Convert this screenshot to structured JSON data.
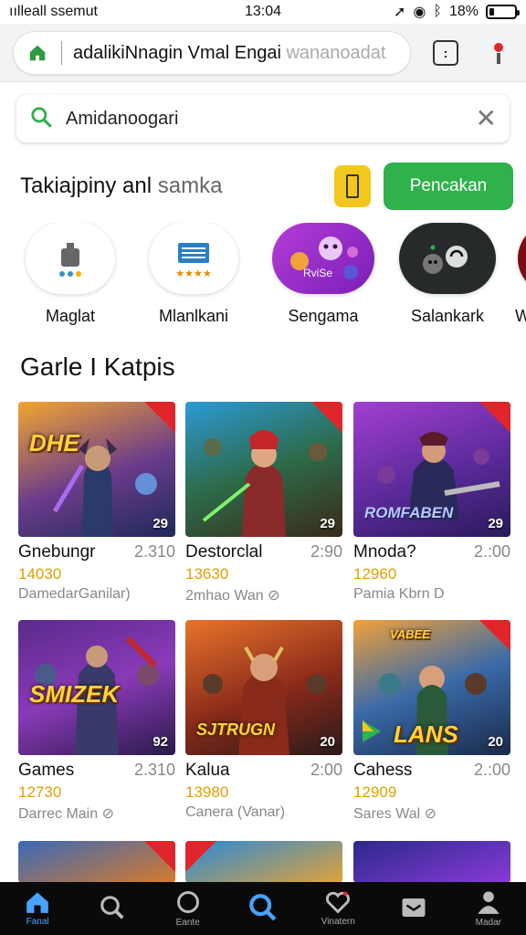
{
  "status_bar": {
    "carrier": "ıılleall ssemut",
    "clock": "13:04",
    "battery": "18%",
    "battery_level": 0.18
  },
  "url_bar": {
    "url_text": "adalikiNnagin Vmal Engai",
    "url_faded": "wananoadat",
    "tabs_count": ":"
  },
  "search": {
    "query": "Amidanoogari"
  },
  "section": {
    "title": "Takiajpiny anl",
    "title_faded": "samka",
    "action_button": "Pencakan"
  },
  "categories": [
    {
      "label": "Maglat",
      "icon": "package-icon"
    },
    {
      "label": "Mlanlkani",
      "icon": "list-icon"
    },
    {
      "label": "Sengama",
      "icon": "monster-faces-icon",
      "caption": "RviSe"
    },
    {
      "label": "Salankark",
      "icon": "bomb-icon"
    },
    {
      "label": "W",
      "icon": "partial-icon"
    }
  ],
  "games_heading": "Garle I Katpis",
  "games": [
    {
      "name": "Gnebungr",
      "price": "2.310",
      "count": "14030",
      "sub": "DamedarGanilar)",
      "rating": "29",
      "banner": "DHE"
    },
    {
      "name": "Destorclal",
      "price": "2:90",
      "count": "13630",
      "sub": "2mhao Wan  ⊘",
      "rating": "29",
      "banner": ""
    },
    {
      "name": "Mnoda?",
      "price": "2.:00",
      "count": "12960",
      "sub": "Pamia Kbrn  D",
      "rating": "29",
      "banner": "ROMFABEN"
    },
    {
      "name": "Games",
      "price": "2.310",
      "count": "12730",
      "sub": "Darrec Main  ⊘",
      "rating": "92",
      "banner": "SMIZEK"
    },
    {
      "name": "Kalua",
      "price": "2:00",
      "count": "13980",
      "sub": "Canera (Vanar)",
      "rating": "20",
      "banner": "SJTRUGN"
    },
    {
      "name": "Cahess",
      "price": "2.:00",
      "count": "12909",
      "sub": "Sares Wal  ⊘",
      "rating": "20",
      "banner": "LANS"
    }
  ],
  "bottom_nav": [
    {
      "label": "Fanal",
      "icon": "home-icon",
      "active": true
    },
    {
      "label": "",
      "icon": "search-icon",
      "active": false
    },
    {
      "label": "Eante",
      "icon": "circle-icon",
      "active": false
    },
    {
      "label": "",
      "icon": "search-active-icon",
      "active": false
    },
    {
      "label": "Vinatern",
      "icon": "heart-icon",
      "active": false
    },
    {
      "label": "",
      "icon": "inbox-icon",
      "active": false
    },
    {
      "label": "Madar",
      "icon": "person-icon",
      "active": false
    }
  ],
  "colors": {
    "accent_green": "#2fb14c",
    "accent_yellow": "#f2c81f",
    "nav_active": "#4aa3ff",
    "star": "#e0a000"
  }
}
